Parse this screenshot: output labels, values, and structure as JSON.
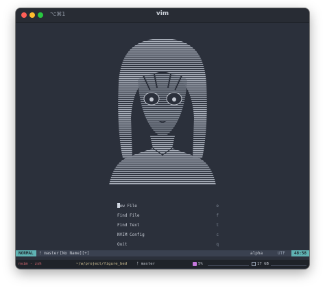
{
  "window": {
    "title": "vim",
    "shortcut": "⌥⌘1"
  },
  "dashboard": {
    "items": [
      {
        "icon": "",
        "label": "New File",
        "key": "e"
      },
      {
        "icon": "",
        "label": "Find File",
        "key": "f"
      },
      {
        "icon": "",
        "label": "Find Text",
        "key": "t"
      },
      {
        "icon": "",
        "label": "NVIM Config",
        "key": "c"
      },
      {
        "icon": "",
        "label": "Quit",
        "key": "q"
      }
    ]
  },
  "statusline": {
    "mode": "NORMAL",
    "branch": "ᚠ master",
    "buffer": "[No Name][+]",
    "filetype": "alpha",
    "encoding": "UTF",
    "position": "48:58"
  },
  "tmux": {
    "session": "nvim - zsh",
    "path": "~/w/project/figure_bed",
    "branch": "ᚠ master",
    "cpu": "5%",
    "disk": "17 GB"
  },
  "colors": {
    "background": "#2b303b",
    "art": "#a9afba",
    "mode_bg": "#5fb3b3"
  }
}
